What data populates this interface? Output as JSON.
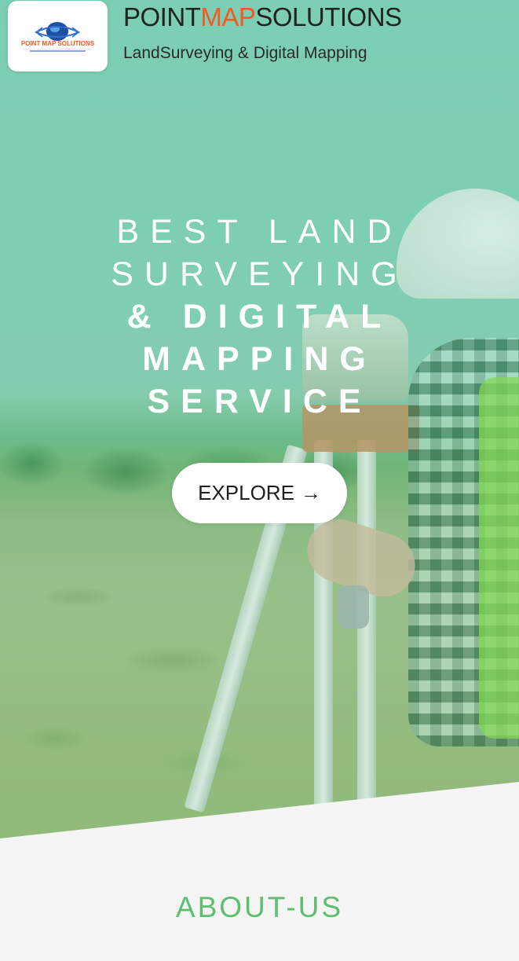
{
  "header": {
    "brand_part1": "POINT",
    "brand_part2": "MAP",
    "brand_part3": "SOLUTIONS",
    "tagline": "LandSurveying & Digital Mapping",
    "logo_text": "POINT MAP SOLUTIONS"
  },
  "hero": {
    "line1": "BEST LAND",
    "line2": "SURVEYING",
    "line3": "& DIGITAL",
    "line4": "MAPPING",
    "line5": "SERVICE",
    "button_label": "EXPLORE",
    "button_arrow": "→"
  },
  "about": {
    "heading": "ABOUT-US"
  },
  "colors": {
    "accent": "#f15a22",
    "heading_green": "#5cc06e",
    "hero_tint": "#60c8a0"
  }
}
